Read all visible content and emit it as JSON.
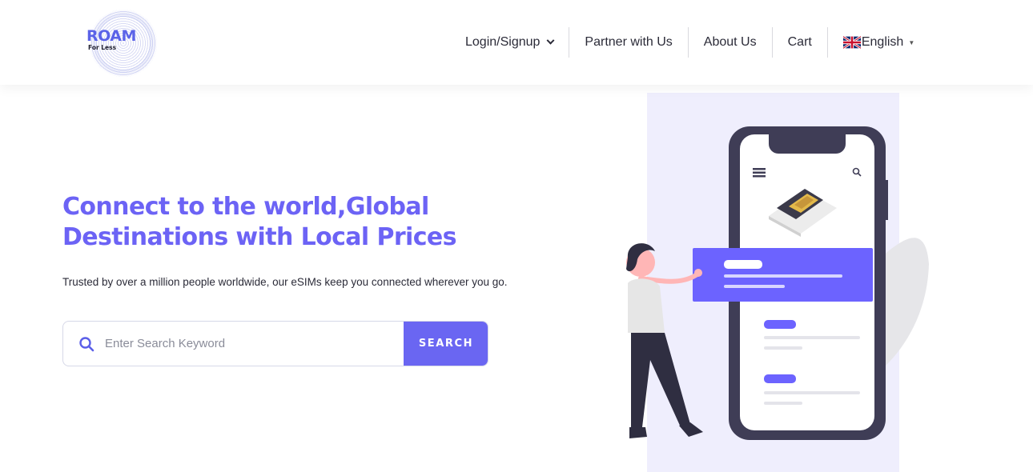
{
  "header": {
    "logo": {
      "main": "ROAM",
      "sub": "For Less"
    },
    "nav": [
      {
        "label": "Login/Signup",
        "has_dropdown": true
      },
      {
        "label": "Partner with Us"
      },
      {
        "label": "About Us"
      },
      {
        "label": "Cart"
      },
      {
        "label": "English",
        "flag_icon": "uk-flag-icon",
        "has_dropdown": true
      }
    ]
  },
  "hero": {
    "title_line1": "Connect to the world,Global",
    "title_line2": "Destinations with Local Prices",
    "subtitle": "Trusted by over a million people worldwide, our eSIMs keep you connected wherever you go.",
    "search": {
      "placeholder": "Enter Search Keyword",
      "value": "",
      "button_label": "SEARCH",
      "icon": "search-icon"
    }
  },
  "colors": {
    "accent": "#6a66f2",
    "title": "#6c63f5",
    "phone_frame": "#3f3d56",
    "panel_bg": "#efeefd"
  }
}
